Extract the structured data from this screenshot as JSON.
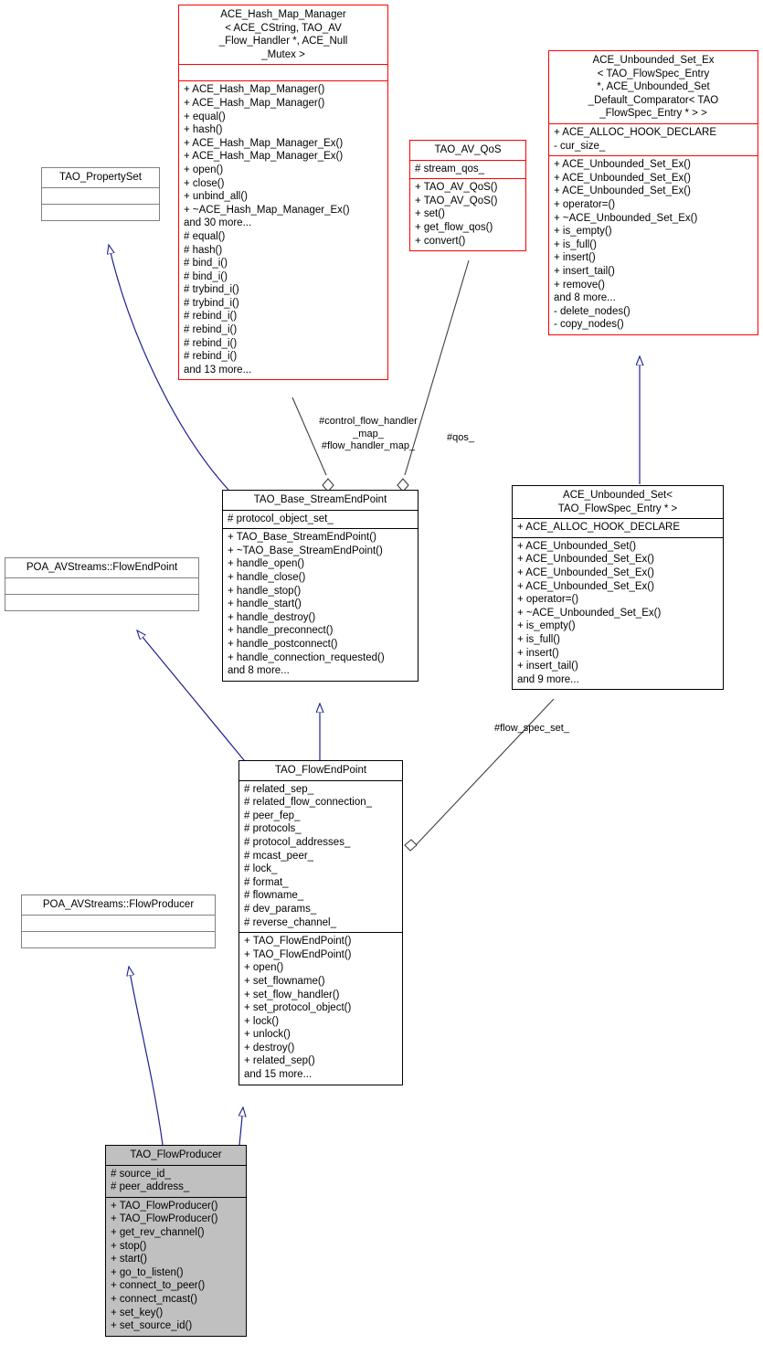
{
  "diagram": {
    "kind": "uml-collaboration-diagram",
    "root_class": "TAO_FlowProducer",
    "colors": {
      "template_class_border": "#ff0000",
      "plain_class_border": "#000000",
      "external_class_border": "#808080",
      "highlight_fill": "#c0c0c0",
      "inheritance_edge": "#1f1f8f",
      "usage_edge": "#404040"
    }
  },
  "classes": {
    "ace_hash_map_manager": {
      "title": "ACE_Hash_Map_Manager\n< ACE_CString, TAO_AV\n_Flow_Handler *, ACE_Null\n_Mutex >",
      "attributes": "",
      "methods": "+ ACE_Hash_Map_Manager()\n+ ACE_Hash_Map_Manager()\n+ equal()\n+ hash()\n+ ACE_Hash_Map_Manager_Ex()\n+ ACE_Hash_Map_Manager_Ex()\n+ open()\n+ close()\n+ unbind_all()\n+ ~ACE_Hash_Map_Manager_Ex()\nand 30 more...\n# equal()\n# hash()\n# bind_i()\n# bind_i()\n# trybind_i()\n# trybind_i()\n# rebind_i()\n# rebind_i()\n# rebind_i()\n# rebind_i()\nand 13 more..."
    },
    "tao_property_set": {
      "title": "TAO_PropertySet",
      "attributes": "",
      "methods": ""
    },
    "tao_av_qos": {
      "title": "TAO_AV_QoS",
      "attributes": "# stream_qos_",
      "methods": "+ TAO_AV_QoS()\n+ TAO_AV_QoS()\n+ set()\n+ get_flow_qos()\n+ convert()"
    },
    "ace_unbounded_set_ex": {
      "title": "ACE_Unbounded_Set_Ex\n< TAO_FlowSpec_Entry\n *, ACE_Unbounded_Set\n_Default_Comparator< TAO\n_FlowSpec_Entry * > >",
      "attributes": "+ ACE_ALLOC_HOOK_DECLARE\n- cur_size_",
      "methods": "+ ACE_Unbounded_Set_Ex()\n+ ACE_Unbounded_Set_Ex()\n+ ACE_Unbounded_Set_Ex()\n+ operator=()\n+ ~ACE_Unbounded_Set_Ex()\n+ is_empty()\n+ is_full()\n+ insert()\n+ insert_tail()\n+ remove()\nand 8 more...\n- delete_nodes()\n- copy_nodes()"
    },
    "ace_unbounded_set": {
      "title": "ACE_Unbounded_Set<\nTAO_FlowSpec_Entry * >",
      "attributes": "+ ACE_ALLOC_HOOK_DECLARE",
      "methods": "+ ACE_Unbounded_Set()\n+ ACE_Unbounded_Set_Ex()\n+ ACE_Unbounded_Set_Ex()\n+ ACE_Unbounded_Set_Ex()\n+ operator=()\n+ ~ACE_Unbounded_Set_Ex()\n+ is_empty()\n+ is_full()\n+ insert()\n+ insert_tail()\nand 9 more..."
    },
    "tao_base_streamendpoint": {
      "title": "TAO_Base_StreamEndPoint",
      "attributes": "# protocol_object_set_",
      "methods": "+ TAO_Base_StreamEndPoint()\n+ ~TAO_Base_StreamEndPoint()\n+ handle_open()\n+ handle_close()\n+ handle_stop()\n+ handle_start()\n+ handle_destroy()\n+ handle_preconnect()\n+ handle_postconnect()\n+ handle_connection_requested()\nand 8 more..."
    },
    "poa_avstreams_flowendpoint": {
      "title": "POA_AVStreams::FlowEndPoint",
      "attributes": "",
      "methods": ""
    },
    "tao_flowendpoint": {
      "title": "TAO_FlowEndPoint",
      "attributes": "# related_sep_\n# related_flow_connection_\n# peer_fep_\n# protocols_\n# protocol_addresses_\n# mcast_peer_\n# lock_\n# format_\n# flowname_\n# dev_params_\n# reverse_channel_",
      "methods": "+ TAO_FlowEndPoint()\n+ TAO_FlowEndPoint()\n+ open()\n+ set_flowname()\n+ set_flow_handler()\n+ set_protocol_object()\n+ lock()\n+ unlock()\n+ destroy()\n+ related_sep()\nand 15 more..."
    },
    "poa_avstreams_flowproducer": {
      "title": "POA_AVStreams::FlowProducer",
      "attributes": "",
      "methods": ""
    },
    "tao_flowproducer": {
      "title": "TAO_FlowProducer",
      "attributes": "# source_id_\n# peer_address_",
      "methods": "+ TAO_FlowProducer()\n+ TAO_FlowProducer()\n+ get_rev_channel()\n+ stop()\n+ start()\n+ go_to_listen()\n+ connect_to_peer()\n+ connect_mcast()\n+ set_key()\n+ set_source_id()"
    }
  },
  "edge_labels": {
    "control_flow_handler_map": "#control_flow_handler\n_map_\n#flow_handler_map_",
    "qos": "#qos_",
    "flow_spec_set": "#flow_spec_set_"
  }
}
